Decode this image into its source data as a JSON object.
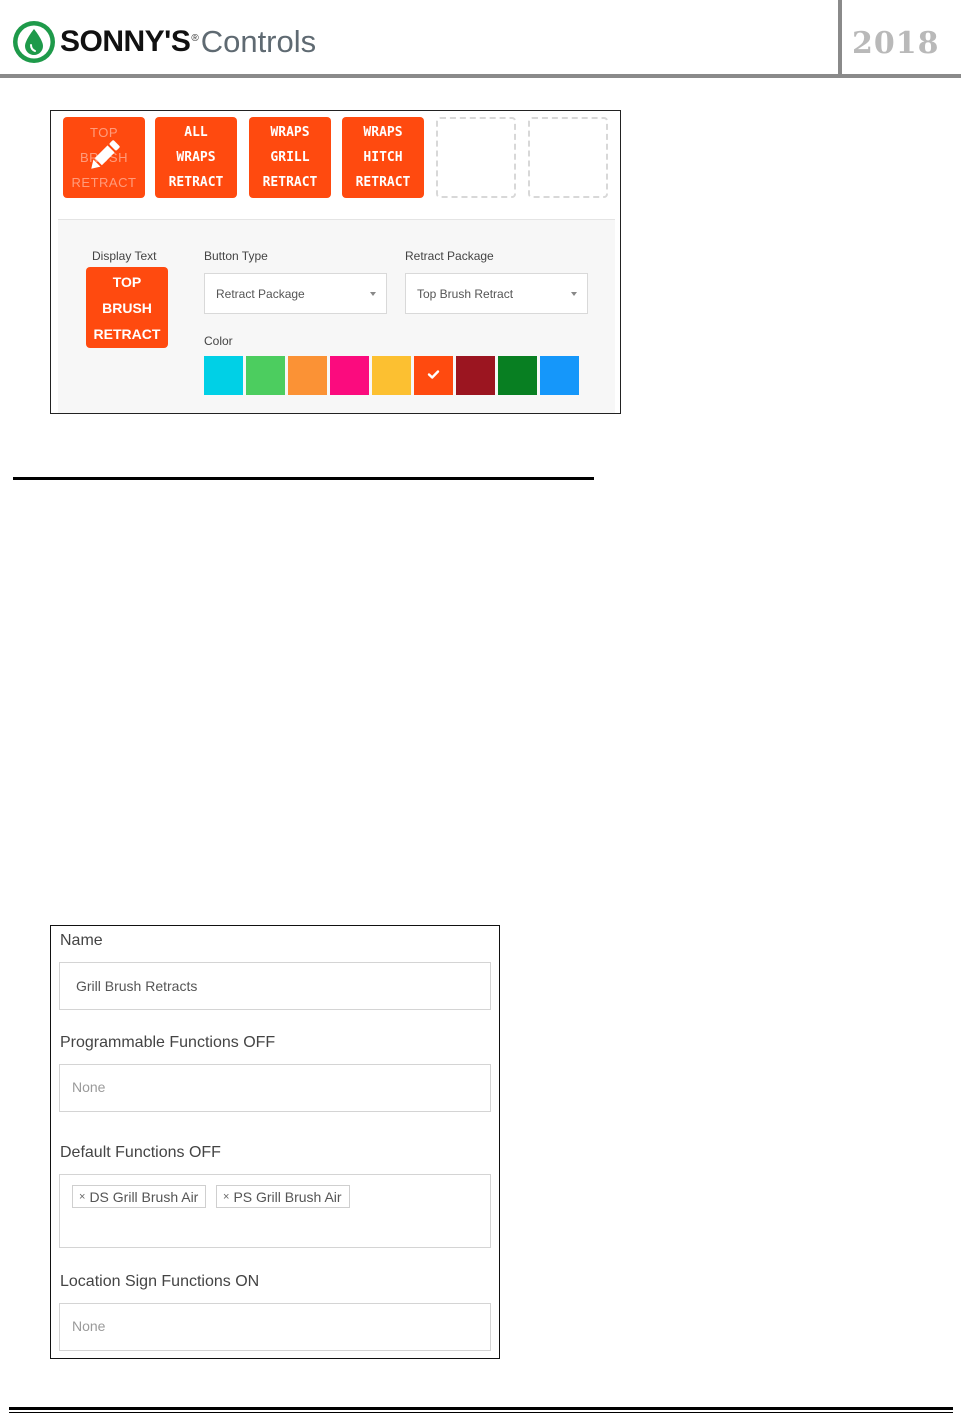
{
  "header": {
    "brand": "SONNY'S",
    "brand_mark": "®",
    "product": "Controls",
    "year": "2018",
    "logo_icon": "water-drop-icon",
    "logo_color": "#1e9a4a"
  },
  "button_editor": {
    "tiles": [
      {
        "lines": [
          "TOP",
          "BRUSH",
          "RETRACT"
        ],
        "state": "editing",
        "icon": "pencil-icon"
      },
      {
        "lines": [
          "ALL",
          "WRAPS",
          "RETRACT"
        ]
      },
      {
        "lines": [
          "WRAPS",
          "GRILL",
          "RETRACT"
        ]
      },
      {
        "lines": [
          "WRAPS",
          "HITCH",
          "RETRACT"
        ]
      }
    ],
    "empty_slots": 2,
    "accent_color": "#ff4a0f",
    "display_text": {
      "label": "Display Text",
      "preview_lines": [
        "TOP",
        "BRUSH",
        "RETRACT"
      ]
    },
    "button_type": {
      "label": "Button Type",
      "value": "Retract Package"
    },
    "retract_package": {
      "label": "Retract Package",
      "value": "Top Brush Retract"
    },
    "color": {
      "label": "Color",
      "swatches": [
        "#00d0e6",
        "#4ccd5f",
        "#fb9235",
        "#fb0b7e",
        "#fcc031",
        "#ff4a0f",
        "#9b1520",
        "#087f22",
        "#1597fa"
      ],
      "selected_index": 5
    }
  },
  "form": {
    "name": {
      "label": "Name",
      "value": "Grill Brush Retracts"
    },
    "programmable_off": {
      "label": "Programmable Functions OFF",
      "placeholder": "None"
    },
    "default_off": {
      "label": "Default Functions OFF",
      "tags": [
        "DS Grill Brush Air",
        "PS Grill Brush Air"
      ],
      "remove_glyph": "×"
    },
    "location_sign_on": {
      "label": "Location Sign Functions ON",
      "placeholder": "None"
    }
  }
}
